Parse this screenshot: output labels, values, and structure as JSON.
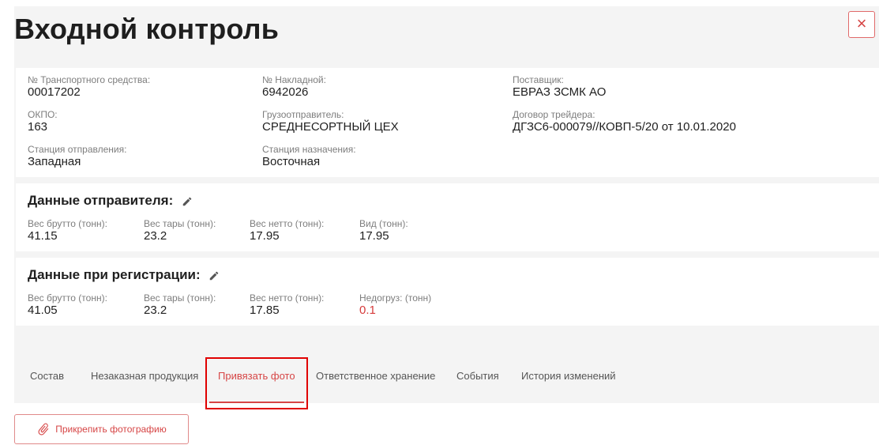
{
  "page": {
    "title": "Входной контроль"
  },
  "close_icon": "×",
  "info": {
    "vehicle_label": "№ Транспортного средства:",
    "vehicle_value": "00017202",
    "okpo_label": "ОКПО:",
    "okpo_value": "163",
    "departure_label": "Станция отправления:",
    "departure_value": "Западная",
    "waybill_label": "№ Накладной:",
    "waybill_value": "6942026",
    "shipper_label": "Грузоотправитель:",
    "shipper_value": "СРЕДНЕСОРТНЫЙ ЦЕХ",
    "destination_label": "Станция назначения:",
    "destination_value": "Восточная",
    "supplier_label": "Поставщик:",
    "supplier_value": "ЕВРАЗ ЗСМК АО",
    "contract_label": "Договор трейдера:",
    "contract_value": "ДГЗС6-000079//КОВП-5/20 от 10.01.2020"
  },
  "sender": {
    "title": "Данные отправителя:",
    "gross_label": "Вес брутто (тонн):",
    "gross_value": "41.15",
    "tare_label": "Вес тары (тонн):",
    "tare_value": "23.2",
    "net_label": "Вес нетто (тонн):",
    "net_value": "17.95",
    "kind_label": "Вид (тонн):",
    "kind_value": "17.95"
  },
  "registration": {
    "title": "Данные при регистрации:",
    "gross_label": "Вес брутто (тонн):",
    "gross_value": "41.05",
    "tare_label": "Вес тары (тонн):",
    "tare_value": "23.2",
    "net_label": "Вес нетто (тонн):",
    "net_value": "17.85",
    "shortage_label": "Недогруз: (тонн)",
    "shortage_value": "0.1"
  },
  "tabs": [
    {
      "label": "Состав"
    },
    {
      "label": "Незаказная продукция"
    },
    {
      "label": "Привязать фото",
      "active": true
    },
    {
      "label": "Ответственное хранение"
    },
    {
      "label": "События"
    },
    {
      "label": "История изменений"
    }
  ],
  "attach_button": {
    "label": "Прикрепить фотографию"
  },
  "colors": {
    "accent": "#d64545",
    "panel": "#f4f4f4",
    "highlight": "#e00000"
  }
}
